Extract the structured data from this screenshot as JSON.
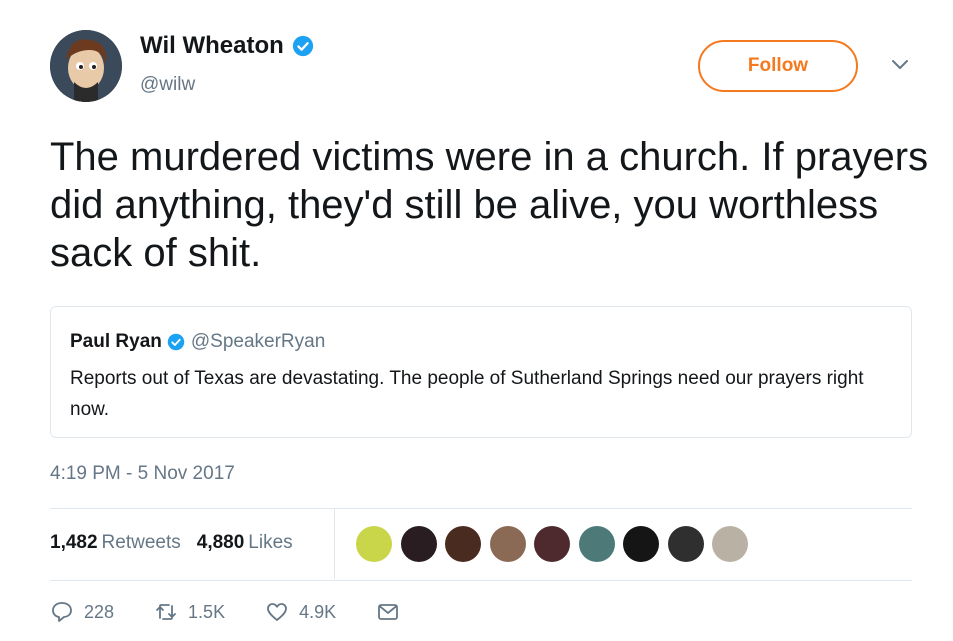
{
  "author": {
    "name": "Wil Wheaton",
    "handle": "@wilw",
    "verified": true,
    "avatar_icon": "user-avatar"
  },
  "follow_label": "Follow",
  "tweet_text": "The murdered victims were in a church. If prayers did anything, they'd still be alive, you worthless sack of shit.",
  "quoted_tweet": {
    "name": "Paul Ryan",
    "handle": "@SpeakerRyan",
    "verified": true,
    "text": "Reports out of Texas are devastating. The people of Sutherland Springs need our prayers right now."
  },
  "timestamp": "4:19 PM - 5 Nov 2017",
  "stats": {
    "retweets_count": "1,482",
    "retweets_label": "Retweets",
    "likes_count": "4,880",
    "likes_label": "Likes"
  },
  "liker_avatars": [
    {
      "color": "#c9d64a"
    },
    {
      "color": "#2a1d22"
    },
    {
      "color": "#4a2b1f"
    },
    {
      "color": "#8a6a55"
    },
    {
      "color": "#4e2a2e"
    },
    {
      "color": "#4d7a78"
    },
    {
      "color": "#151515"
    },
    {
      "color": "#2f2f2f"
    },
    {
      "color": "#b9b2a4"
    }
  ],
  "actions": {
    "reply_count": "228",
    "retweet_count": "1.5K",
    "like_count": "4.9K"
  },
  "colors": {
    "accent": "#f4791f",
    "verified": "#1da1f2",
    "muted": "#657786",
    "border": "#e1e8ed"
  }
}
